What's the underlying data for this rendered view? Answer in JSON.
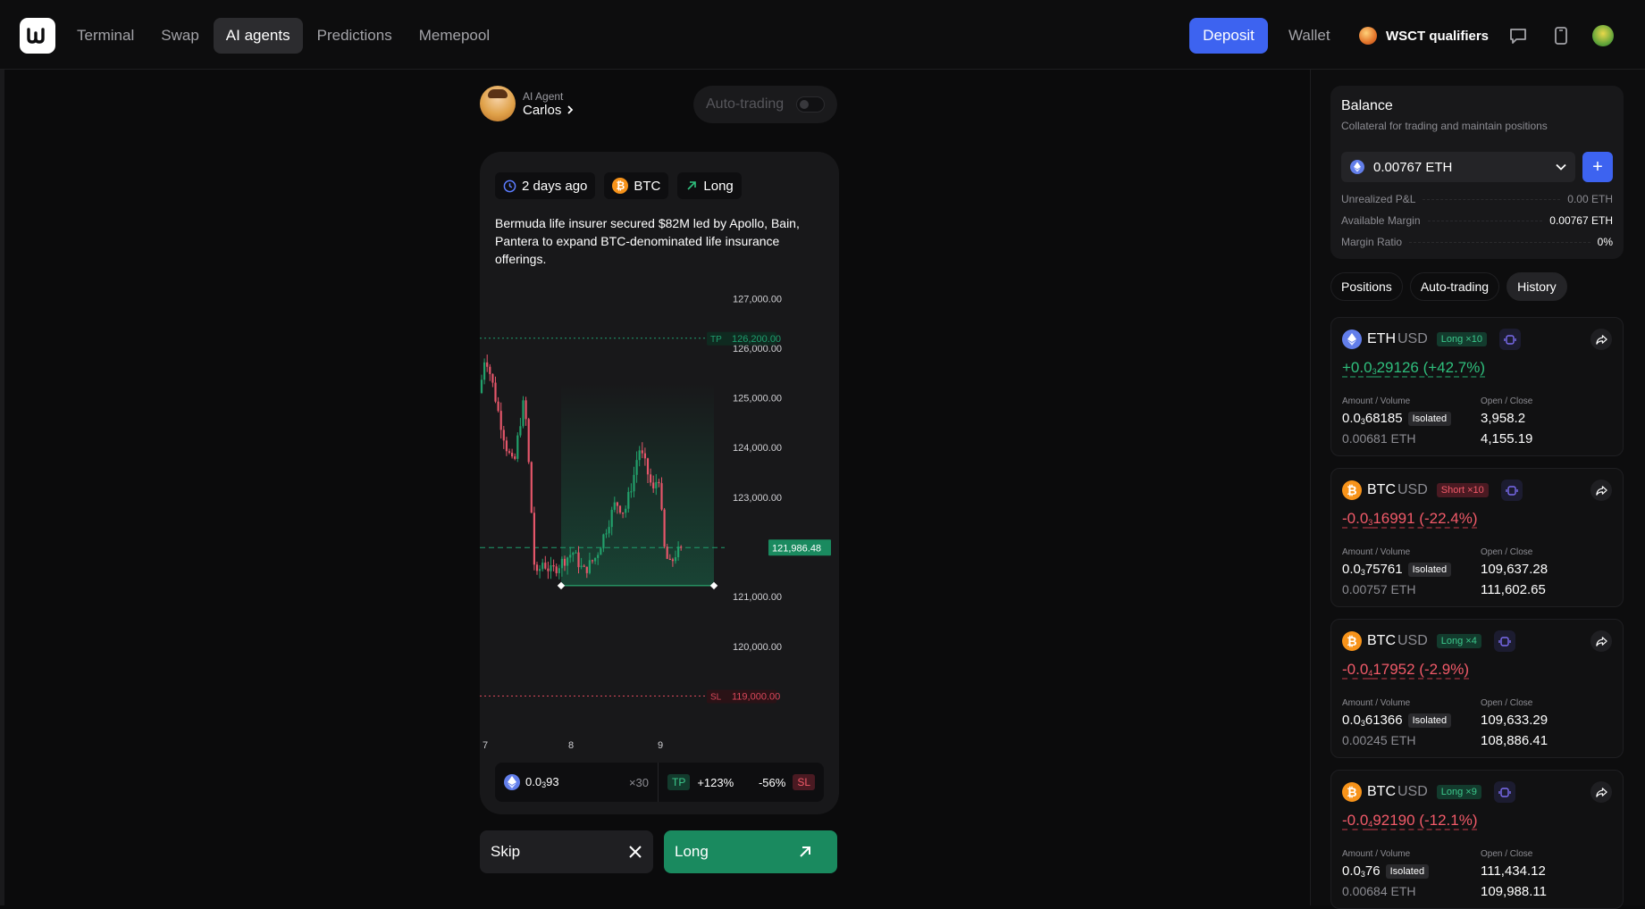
{
  "topbar": {
    "nav": [
      "Terminal",
      "Swap",
      "AI agents",
      "Predictions",
      "Memepool"
    ],
    "active_nav": "AI agents",
    "deposit_label": "Deposit",
    "wallet_label": "Wallet",
    "event_label": "WSCT qualifiers",
    "icons": [
      "logo-icon",
      "chat-icon",
      "mobile-icon",
      "avatar"
    ]
  },
  "agent": {
    "subtitle": "AI Agent",
    "name": "Carlos",
    "autotrading_label": "Auto-trading",
    "autotrading_on": false
  },
  "signal": {
    "time": "2 days ago",
    "asset": "BTC",
    "direction": "Long",
    "headline": "Bermuda life insurer secured $82M led by Apollo, Bain, Pantera to expand BTC-denominated life insurance offerings.",
    "amount_prefix": "0.0",
    "amount_sub": "3",
    "amount_rest": "93",
    "leverage": "×30",
    "tp_tag": "TP",
    "tp_pct": "+123%",
    "sl_pct": "-56%",
    "sl_tag": "SL",
    "skip_label": "Skip",
    "long_label": "Long"
  },
  "chart_data": {
    "type": "candlestick",
    "y_ticks": [
      "127,000.00",
      "126,000.00",
      "125,000.00",
      "124,000.00",
      "123,000.00",
      "121,000.00",
      "120,000.00"
    ],
    "ylim": [
      118200,
      127400
    ],
    "x_ticks": [
      "7",
      "8",
      "9"
    ],
    "tp_label": "TP",
    "tp_value": "126,200.00",
    "sl_label": "SL",
    "sl_value": "119,000.00",
    "current_value": "121,986.48",
    "entry_level": 121220,
    "colors": {
      "up": "#22a06b",
      "down": "#e5566a",
      "tp": "#1f9e6e",
      "sl": "#d9475a"
    }
  },
  "balance": {
    "title": "Balance",
    "subtitle": "Collateral for trading and maintain positions",
    "selected": "0.00767 ETH",
    "rows": [
      {
        "label": "Unrealized P&L",
        "value": "0.00 ETH"
      },
      {
        "label": "Available Margin",
        "value": "0.00767 ETH"
      },
      {
        "label": "Margin Ratio",
        "value": "0%"
      }
    ]
  },
  "side_tabs": [
    "Positions",
    "Auto-trading",
    "History"
  ],
  "active_side_tab": "History",
  "positions_labels": {
    "amount": "Amount / Volume",
    "open_close": "Open / Close",
    "isolated": "Isolated"
  },
  "positions": [
    {
      "symbol": "ETH",
      "quote": "USD",
      "coin": "eth",
      "side": "Long ×10",
      "side_type": "long",
      "pnl_a": "+0.0",
      "pnl_sub": "3",
      "pnl_b": "29126 (+42.7%)",
      "pnl_type": "pos",
      "amt_a": "0.0",
      "amt_sub": "3",
      "amt_b": "68185",
      "volume": "0.00681 ETH",
      "open": "3,958.2",
      "close": "4,155.19"
    },
    {
      "symbol": "BTC",
      "quote": "USD",
      "coin": "btc",
      "side": "Short ×10",
      "side_type": "short",
      "pnl_a": "-0.0",
      "pnl_sub": "3",
      "pnl_b": "16991 (-22.4%)",
      "pnl_type": "neg",
      "amt_a": "0.0",
      "amt_sub": "3",
      "amt_b": "75761",
      "volume": "0.00757 ETH",
      "open": "109,637.28",
      "close": "111,602.65"
    },
    {
      "symbol": "BTC",
      "quote": "USD",
      "coin": "btc",
      "side": "Long ×4",
      "side_type": "long",
      "pnl_a": "-0.0",
      "pnl_sub": "4",
      "pnl_b": "17952 (-2.9%)",
      "pnl_type": "neg",
      "amt_a": "0.0",
      "amt_sub": "3",
      "amt_b": "61366",
      "volume": "0.00245 ETH",
      "open": "109,633.29",
      "close": "108,886.41"
    },
    {
      "symbol": "BTC",
      "quote": "USD",
      "coin": "btc",
      "side": "Long ×9",
      "side_type": "long",
      "pnl_a": "-0.0",
      "pnl_sub": "4",
      "pnl_b": "92190 (-12.1%)",
      "pnl_type": "neg",
      "amt_a": "0.0",
      "amt_sub": "3",
      "amt_b": "76",
      "volume": "0.00684 ETH",
      "open": "111,434.12",
      "close": "109,988.11"
    }
  ]
}
